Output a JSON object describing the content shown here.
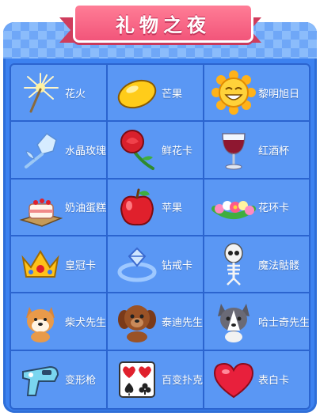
{
  "title": "礼物之夜",
  "colors": {
    "panel": "#3d82f0",
    "cell": "#5a97f4",
    "ribbon": "#f2557a"
  },
  "gifts": [
    {
      "label": "花火",
      "icon": "sparkler-icon"
    },
    {
      "label": "芒果",
      "icon": "mango-icon"
    },
    {
      "label": "黎明旭日",
      "icon": "sun-icon"
    },
    {
      "label": "水晶玫瑰",
      "icon": "crystal-rose-icon"
    },
    {
      "label": "鲜花卡",
      "icon": "rose-icon"
    },
    {
      "label": "红酒杯",
      "icon": "wine-glass-icon"
    },
    {
      "label": "奶油蛋糕",
      "icon": "cake-icon"
    },
    {
      "label": "苹果",
      "icon": "apple-icon"
    },
    {
      "label": "花环卡",
      "icon": "flower-wreath-icon"
    },
    {
      "label": "皇冠卡",
      "icon": "crown-icon"
    },
    {
      "label": "钻戒卡",
      "icon": "diamond-ring-icon"
    },
    {
      "label": "魔法骷髅",
      "icon": "skeleton-icon"
    },
    {
      "label": "柴犬先生",
      "icon": "shiba-dog-icon"
    },
    {
      "label": "泰迪先生",
      "icon": "teddy-dog-icon"
    },
    {
      "label": "哈士奇先生",
      "icon": "husky-dog-icon"
    },
    {
      "label": "变形枪",
      "icon": "ray-gun-icon"
    },
    {
      "label": "百变扑克",
      "icon": "playing-cards-icon"
    },
    {
      "label": "表白卡",
      "icon": "heart-icon"
    }
  ]
}
